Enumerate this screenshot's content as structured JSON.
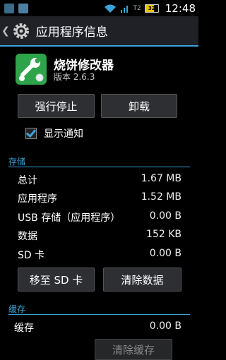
{
  "status_bar": {
    "time": "12:48",
    "network_label": "T2",
    "battery_level": "32",
    "icons": [
      "usb-icon",
      "notification-icon",
      "wifi-icon",
      "signal-icon",
      "battery-icon"
    ]
  },
  "action_bar": {
    "title": "应用程序信息"
  },
  "app": {
    "name": "烧饼修改器",
    "version": "版本 2.6.3"
  },
  "buttons": {
    "force_stop": "强行停止",
    "uninstall": "卸载",
    "move_to_sd": "移至 SD 卡",
    "clear_data": "清除数据",
    "clear_cache": "清除缓存"
  },
  "notifications": {
    "label": "显示通知",
    "checked": true
  },
  "storage": {
    "header": "存储",
    "rows": [
      {
        "label": "总计",
        "value": "1.67 MB"
      },
      {
        "label": "应用程序",
        "value": "1.52 MB"
      },
      {
        "label": "USB 存储（应用程序）",
        "value": "0.00 B"
      },
      {
        "label": "数据",
        "value": "152 KB"
      },
      {
        "label": "SD 卡",
        "value": "0.00 B"
      }
    ]
  },
  "cache": {
    "header": "缓存",
    "rows": [
      {
        "label": "缓存",
        "value": "0.00 B"
      }
    ]
  },
  "colors": {
    "accent": "#3aa3d9",
    "app_icon": "#2fa34a"
  }
}
